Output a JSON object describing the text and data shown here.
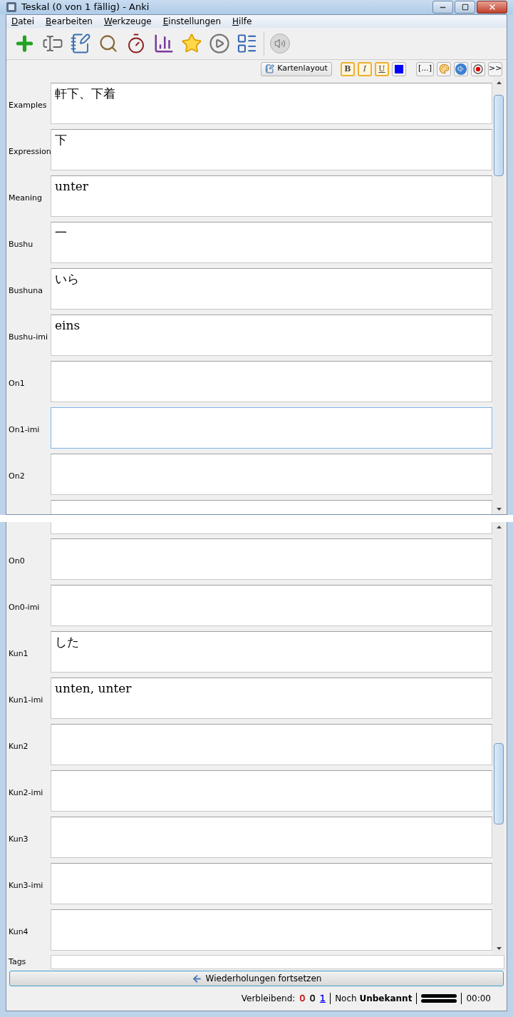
{
  "window": {
    "title": "Teskal (0 von 1 fällig) - Anki"
  },
  "menu": [
    "Datei",
    "Bearbeiten",
    "Werkzeuge",
    "Einstellungen",
    "Hilfe"
  ],
  "format_bar": {
    "card_layout": "Kartenlayout",
    "bold": "B",
    "italic": "I",
    "underline": "U",
    "color": "#0000ff",
    "cloze": "[...]",
    "more": ">>"
  },
  "fields_top": [
    {
      "label": "Examples",
      "value": "軒下、下着",
      "focused": false
    },
    {
      "label": "Expression",
      "value": "下",
      "focused": false
    },
    {
      "label": "Meaning",
      "value": "unter",
      "focused": false
    },
    {
      "label": "Bushu",
      "value": "一",
      "focused": false
    },
    {
      "label": "Bushuna",
      "value": "いら",
      "focused": false
    },
    {
      "label": "Bushu-imi",
      "value": "eins",
      "focused": false
    },
    {
      "label": "On1",
      "focused": false
    },
    {
      "label": "On1-imi",
      "focused": true
    },
    {
      "label": "On2",
      "focused": false
    }
  ],
  "fields_bottom": [
    {
      "label": "On0",
      "focused": false
    },
    {
      "label": "On0-imi",
      "focused": false
    },
    {
      "label": "Kun1",
      "value": "した",
      "focused": false
    },
    {
      "label": "Kun1-imi",
      "value": "unten, unter",
      "focused": false
    },
    {
      "label": "Kun2",
      "focused": false
    },
    {
      "label": "Kun2-imi",
      "focused": false
    },
    {
      "label": "Kun3",
      "focused": false
    },
    {
      "label": "Kun3-imi",
      "focused": false
    },
    {
      "label": "Kun4",
      "focused": false
    }
  ],
  "tags": {
    "label": "Tags"
  },
  "resume_button": "Wiederholungen fortsetzen",
  "status_bar": {
    "remaining_label": "Verbleibend:",
    "counts": [
      {
        "text": "0",
        "color": "#c00000"
      },
      {
        "text": "0",
        "color": "#000000"
      },
      {
        "text": "1",
        "color": "#0000ee"
      }
    ],
    "eta": "Noch **Unbekannt**",
    "time": "00:00"
  }
}
